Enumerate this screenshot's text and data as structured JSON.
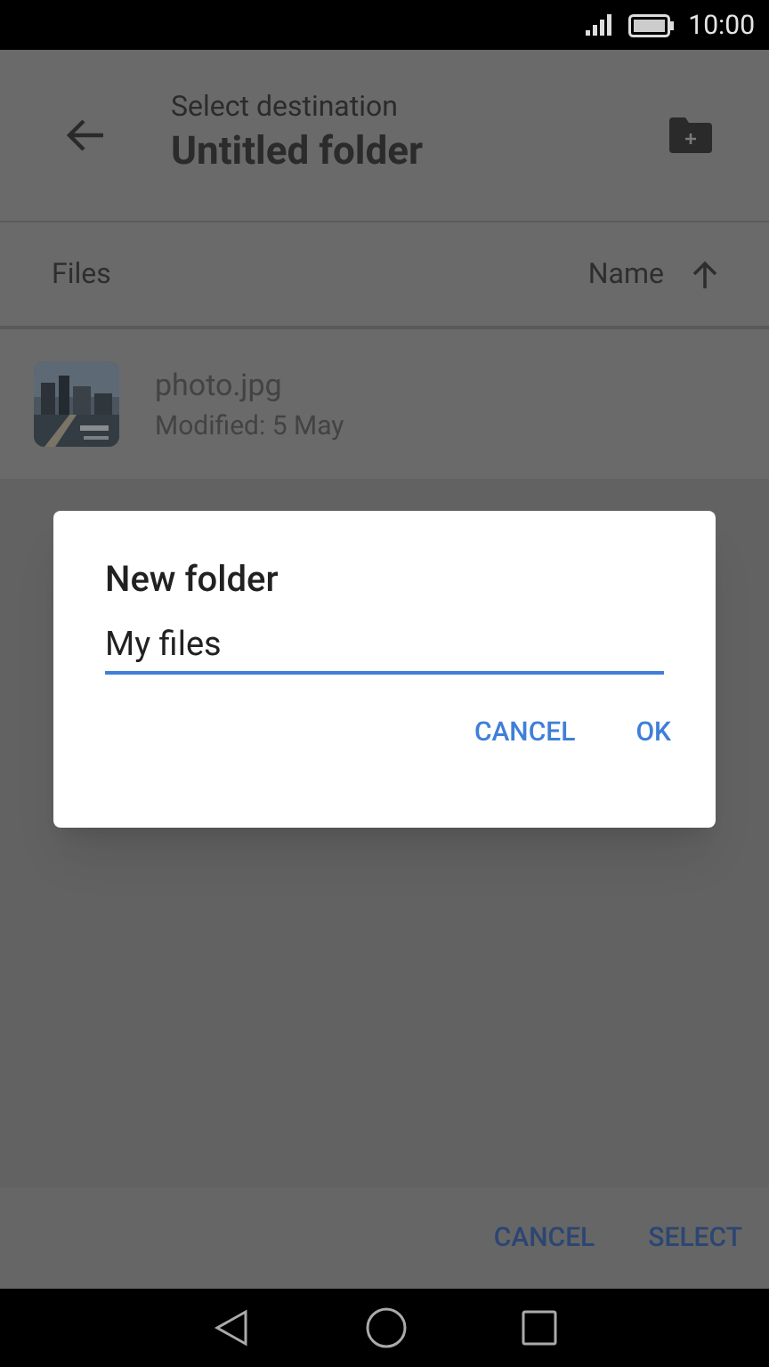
{
  "status_bar": {
    "time": "10:00"
  },
  "header": {
    "subtitle": "Select destination",
    "title": "Untitled folder"
  },
  "list_header": {
    "label": "Files",
    "sort": "Name"
  },
  "files": [
    {
      "name": "photo.jpg",
      "modified": "Modified: 5 May",
      "kind": "picture"
    }
  ],
  "footer": {
    "buttons": [
      "CANCEL",
      "SELECT"
    ]
  },
  "dialog": {
    "title": "New folder",
    "field": {
      "value": "My files"
    },
    "buttons": [
      "CANCEL",
      "OK"
    ]
  }
}
